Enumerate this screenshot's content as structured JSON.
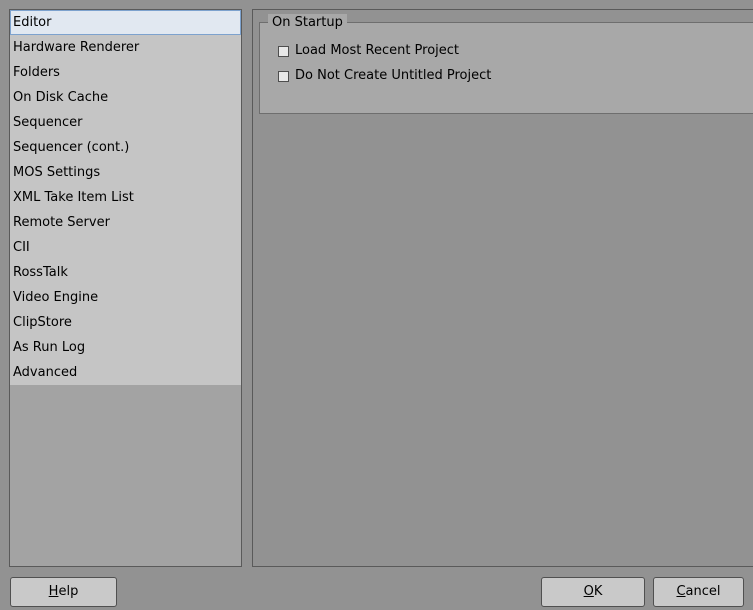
{
  "nav": {
    "items": [
      {
        "label": "Editor",
        "selected": true
      },
      {
        "label": "Hardware Renderer"
      },
      {
        "label": "Folders"
      },
      {
        "label": "On Disk Cache"
      },
      {
        "label": "Sequencer"
      },
      {
        "label": "Sequencer (cont.)"
      },
      {
        "label": "MOS Settings"
      },
      {
        "label": "XML Take Item List"
      },
      {
        "label": "Remote Server"
      },
      {
        "label": "CII"
      },
      {
        "label": "RossTalk"
      },
      {
        "label": "Video Engine"
      },
      {
        "label": "ClipStore"
      },
      {
        "label": "As Run Log"
      },
      {
        "label": "Advanced"
      }
    ]
  },
  "startup": {
    "title": "On Startup",
    "load_recent": {
      "label": "Load Most Recent Project",
      "checked": false
    },
    "no_untitled": {
      "label": "Do Not Create Untitled Project",
      "checked": false
    }
  },
  "buttons": {
    "help": {
      "mnemonic": "H",
      "rest": "elp"
    },
    "ok": {
      "mnemonic": "O",
      "rest": "K"
    },
    "cancel": {
      "mnemonic": "C",
      "rest": "ancel"
    }
  },
  "colors": {
    "background": "#929292",
    "list_background": "#c5c5c5",
    "selection": "#e1e8f1",
    "selection_border": "#7da2ce",
    "group_background": "#a8a8a8"
  }
}
